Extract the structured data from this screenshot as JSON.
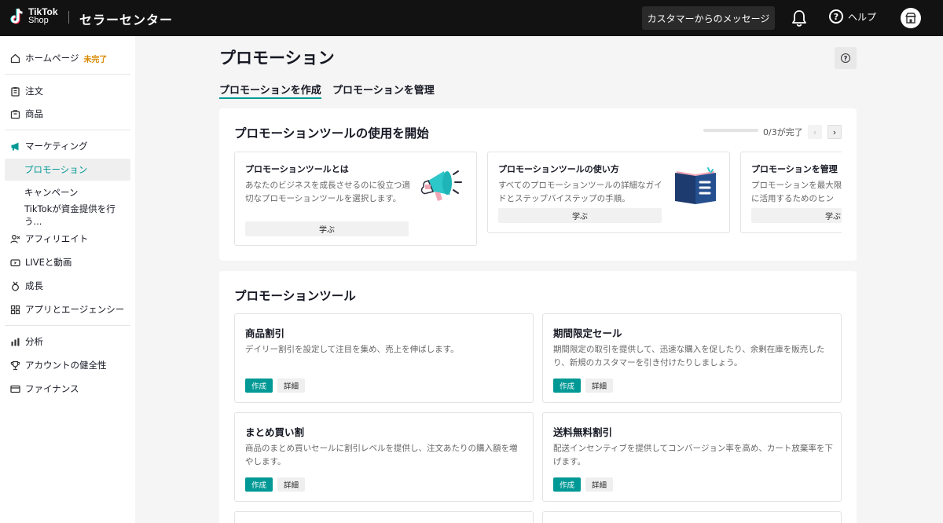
{
  "header": {
    "logo_line1": "TikTok",
    "logo_line2": "Shop",
    "title": "セラーセンター",
    "messages_button": "カスタマーからのメッセージ",
    "help_label": "ヘルプ",
    "help_glyph": "?"
  },
  "sidebar": {
    "items": [
      {
        "label": "ホームページ",
        "badge": "未完了",
        "icon": "home-icon"
      },
      {
        "label": "注文",
        "icon": "clipboard-icon"
      },
      {
        "label": "商品",
        "icon": "box-icon"
      },
      {
        "label": "マーケティング",
        "icon": "megaphone-icon"
      },
      {
        "label": "プロモーション",
        "active": true
      },
      {
        "label": "キャンペーン"
      },
      {
        "label": "TikTokが資金提供を行う..."
      },
      {
        "label": "アフィリエイト",
        "icon": "people-icon"
      },
      {
        "label": "LIVEと動画",
        "icon": "video-icon"
      },
      {
        "label": "成長",
        "icon": "medal-icon"
      },
      {
        "label": "アプリとエージェンシー",
        "icon": "apps-icon"
      },
      {
        "label": "分析",
        "icon": "chart-icon"
      },
      {
        "label": "アカウントの健全性",
        "icon": "trophy-icon"
      },
      {
        "label": "ファイナンス",
        "icon": "card-icon"
      }
    ]
  },
  "main": {
    "title": "プロモーション",
    "help_glyph": "?",
    "tabs": [
      {
        "label": "プロモーションを作成",
        "active": true
      },
      {
        "label": "プロモーションを管理"
      }
    ],
    "getting_started": {
      "title": "プロモーションツールの使用を開始",
      "progress_text": "0/3が完了",
      "progress_fraction": 0,
      "prev_glyph": "‹",
      "next_glyph": "›",
      "cards": [
        {
          "title": "プロモーションツールとは",
          "desc": "あなたのビジネスを成長させるのに役立つ適切なプロモーションツールを選択します。",
          "button": "学ぶ"
        },
        {
          "title": "プロモーションツールの使い方",
          "desc": "すべてのプロモーションツールの詳細なガイドとステップバイステップの手順。",
          "button": "学ぶ"
        },
        {
          "title": "プロモーションを管理",
          "desc": "プロモーションを最大限に活用するためのヒント。",
          "button": "学ぶ"
        }
      ]
    },
    "tools": {
      "title": "プロモーションツール",
      "cards": [
        {
          "title": "商品割引",
          "desc": "デイリー割引を設定して注目を集め、売上を伸ばします。",
          "create": "作成",
          "detail": "詳細"
        },
        {
          "title": "期間限定セール",
          "desc": "期間限定の取引を提供して、迅速な購入を促したり、余剰在庫を販売したり、新規のカスタマーを引き付けたりしましょう。",
          "create": "作成",
          "detail": "詳細"
        },
        {
          "title": "まとめ買い割",
          "desc": "商品のまとめ買いセールに割引レベルを提供し、注文あたりの購入額を増やします。",
          "create": "作成",
          "detail": "詳細"
        },
        {
          "title": "送料無料割引",
          "desc": "配送インセンティブを提供してコンバージョン率を高め、カート放棄率を下げます。",
          "create": "作成",
          "detail": "詳細"
        }
      ]
    }
  },
  "colors": {
    "accent": "#009995",
    "header_bg": "#121212",
    "badge": "#d88a00"
  }
}
